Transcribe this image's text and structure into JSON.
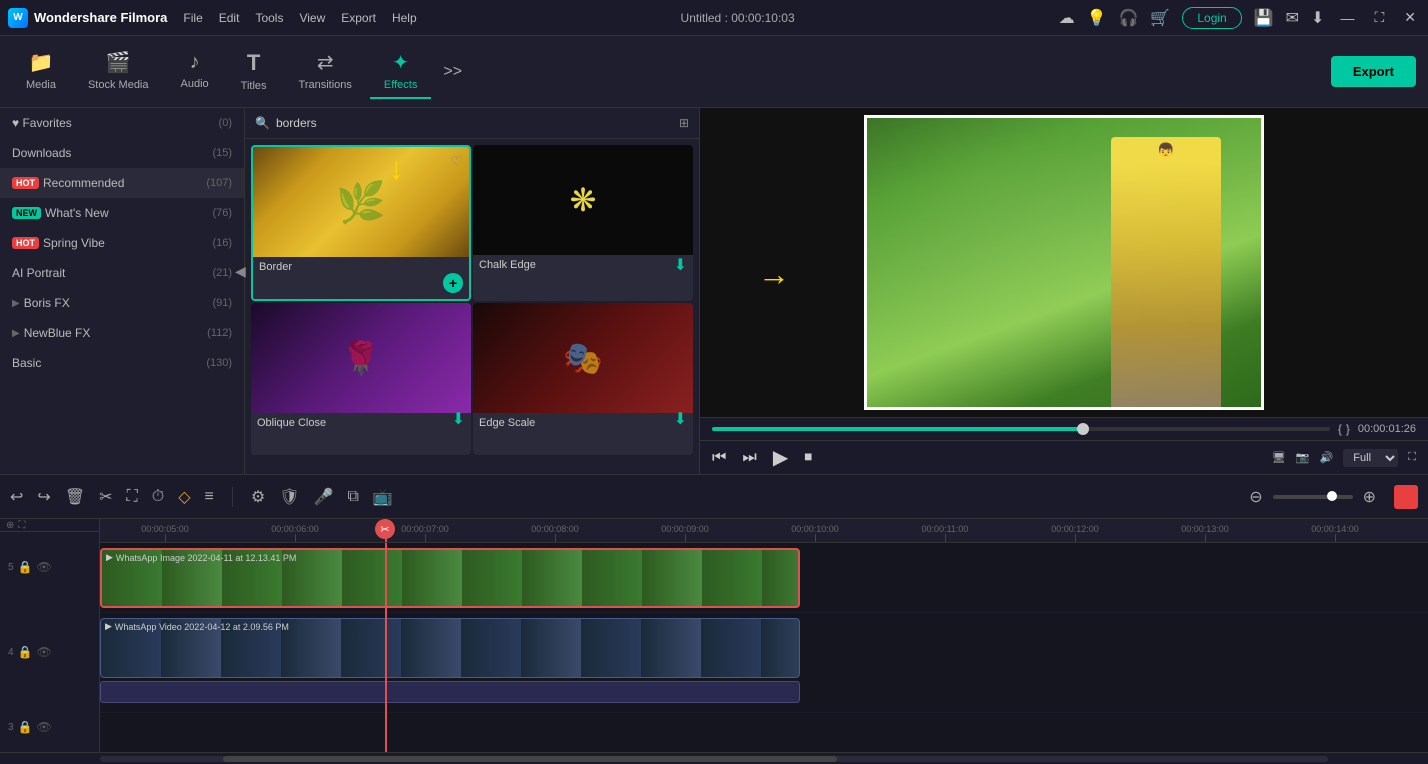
{
  "app": {
    "name": "Wondershare Filmora",
    "title": "Untitled : 00:00:10:03"
  },
  "menubar": {
    "menus": [
      "File",
      "Edit",
      "Tools",
      "View",
      "Export",
      "Help"
    ],
    "right_icons": [
      "☁",
      "💡",
      "🎧",
      "🛒"
    ],
    "login_label": "Login",
    "window_controls": [
      "—",
      "⛶",
      "✕"
    ]
  },
  "toolbar": {
    "items": [
      {
        "id": "media",
        "label": "Media",
        "icon": "📁"
      },
      {
        "id": "stock",
        "label": "Stock Media",
        "icon": "🎬"
      },
      {
        "id": "audio",
        "label": "Audio",
        "icon": "♪"
      },
      {
        "id": "titles",
        "label": "Titles",
        "icon": "T"
      },
      {
        "id": "transitions",
        "label": "Transitions",
        "icon": "⇄"
      },
      {
        "id": "effects",
        "label": "Effects",
        "icon": "✦"
      }
    ],
    "active": "effects",
    "more_icon": ">>",
    "export_label": "Export"
  },
  "left_panel": {
    "items": [
      {
        "id": "favorites",
        "label": "Favorites",
        "count": "(0)",
        "badge": null,
        "arrow": null
      },
      {
        "id": "downloads",
        "label": "Downloads",
        "count": "(15)",
        "badge": null,
        "arrow": null
      },
      {
        "id": "recommended",
        "label": "Recommended",
        "count": "(107)",
        "badge": "HOT",
        "badge_type": "hot",
        "arrow": null
      },
      {
        "id": "whats-new",
        "label": "What's New",
        "count": "(76)",
        "badge": "NEW",
        "badge_type": "new",
        "arrow": null
      },
      {
        "id": "spring-vibe",
        "label": "Spring Vibe",
        "count": "(16)",
        "badge": "HOT",
        "badge_type": "hot",
        "arrow": null
      },
      {
        "id": "ai-portrait",
        "label": "AI Portrait",
        "count": "(21)",
        "badge": null,
        "arrow": null
      },
      {
        "id": "boris-fx",
        "label": "Boris FX",
        "count": "(91)",
        "badge": null,
        "arrow": "▶"
      },
      {
        "id": "newblue-fx",
        "label": "NewBlue FX",
        "count": "(112)",
        "badge": null,
        "arrow": "▶"
      },
      {
        "id": "basic",
        "label": "Basic",
        "count": "(130)",
        "badge": null,
        "arrow": null
      }
    ]
  },
  "effects_panel": {
    "search_placeholder": "borders",
    "search_value": "borders",
    "effects": [
      {
        "id": "border",
        "label": "Border",
        "thumb_class": "thumb-border",
        "selected": true,
        "has_heart": true,
        "has_add": true
      },
      {
        "id": "chalk-edge",
        "label": "Chalk Edge",
        "thumb_class": "thumb-chalk",
        "selected": false,
        "has_heart": false,
        "has_download": true
      },
      {
        "id": "oblique-close",
        "label": "Oblique Close",
        "thumb_class": "thumb-oblique",
        "selected": false,
        "has_heart": false,
        "has_download": true
      },
      {
        "id": "edge-scale",
        "label": "Edge Scale",
        "thumb_class": "thumb-edge",
        "selected": false,
        "has_heart": false,
        "has_download": true
      }
    ]
  },
  "preview": {
    "time_display": "00:00:01:26",
    "progress_percent": 60,
    "zoom_level": "Full",
    "controls": {
      "rewind": "⏮",
      "step_back": "⏮",
      "play": "▶",
      "stop": "⏹"
    },
    "bracket_left": "{",
    "bracket_right": "}"
  },
  "timeline": {
    "tools": [
      "↩",
      "↪",
      "🗑",
      "✂",
      "⛶",
      "⏱",
      "◇",
      "≡",
      "⊕",
      "☰"
    ],
    "ruler_marks": [
      "00:00:05:00",
      "00:00:06:00",
      "00:00:07:00",
      "00:00:08:00",
      "00:00:09:00",
      "00:00:10:00",
      "00:00:11:00",
      "00:00:12:00",
      "00:00:13:00",
      "00:00:14:00"
    ],
    "tracks": [
      {
        "num": "5",
        "icons": [
          "🔒",
          "👁"
        ],
        "clip_label": "WhatsApp Image 2022-04-11 at 12.13.41 PM",
        "clip_type": "video"
      },
      {
        "num": "4",
        "icons": [
          "🔒",
          "👁"
        ],
        "clip_label": "WhatsApp Video 2022-04-12 at 2.09.56 PM",
        "clip_type": "video2"
      },
      {
        "num": "3",
        "icons": [
          "🔒",
          "👁"
        ],
        "clip_label": "",
        "clip_type": "empty"
      }
    ]
  },
  "annotations": {
    "yellow_arrow_down": "↓",
    "yellow_arrow_right": "→"
  }
}
